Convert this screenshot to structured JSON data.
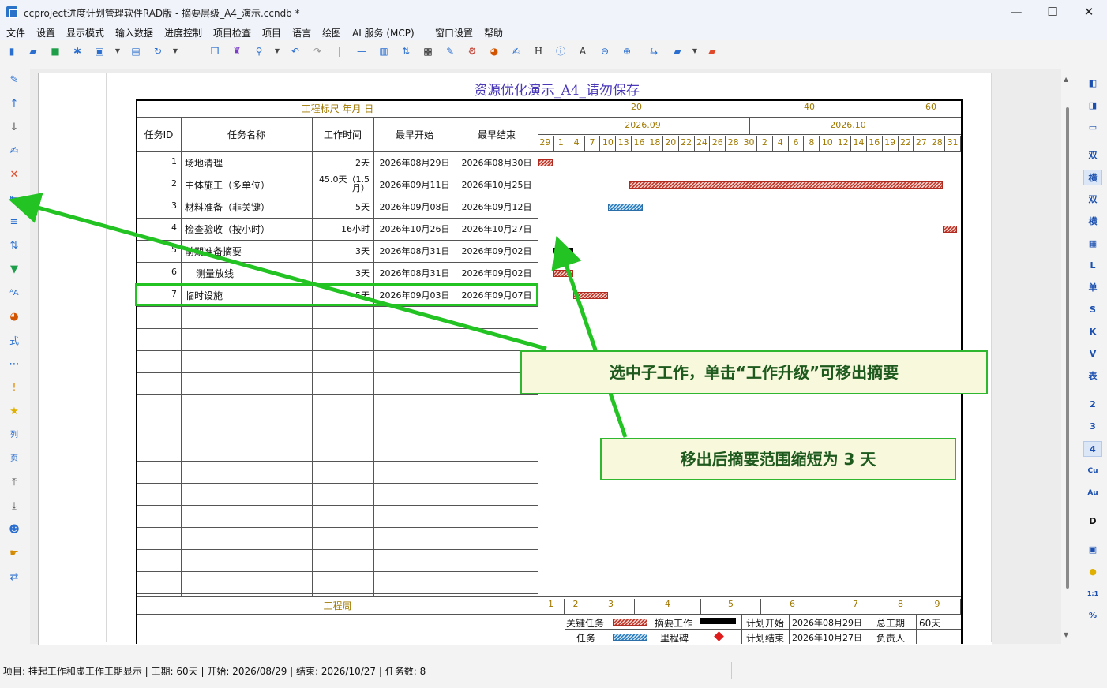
{
  "window": {
    "title": "ccproject进度计划管理软件RAD版 - 摘要层级_A4_演示.ccndb *",
    "minimize": "—",
    "maximize": "☐",
    "close": "✕"
  },
  "menu": [
    "文件",
    "设置",
    "显示模式",
    "输入数据",
    "进度控制",
    "项目检查",
    "项目",
    "语言",
    "绘图",
    "AI 服务 (MCP)",
    "窗口设置",
    "帮助"
  ],
  "toolbar_icons": [
    "new-file",
    "open-folder",
    "save",
    "asterisk",
    "image-export",
    "dropdown",
    "print",
    "refresh",
    "dropdown",
    "copy",
    "paint",
    "zoom",
    "dropdown",
    "undo",
    "redo",
    "separator",
    "line",
    "columns",
    "sort",
    "qr",
    "brush",
    "settings-doc",
    "palette",
    "edit",
    "H",
    "info",
    "A",
    "zoom-out",
    "zoom-in",
    "arrows",
    "folder",
    "dropdown",
    "folder-red"
  ],
  "chart": {
    "title": "资源优化演示_A4_请勿保存",
    "scale_title": "工程标尺 年月 日",
    "scale_numbers": [
      "20",
      "40",
      "60"
    ],
    "months": [
      "2026.09",
      "2026.10"
    ],
    "days": [
      "29",
      "1",
      "4",
      "7",
      "10",
      "13",
      "16",
      "18",
      "20",
      "22",
      "24",
      "26",
      "28",
      "30",
      "2",
      "4",
      "6",
      "8",
      "10",
      "12",
      "14",
      "16",
      "19",
      "22",
      "27",
      "28",
      "31"
    ],
    "columns": {
      "id": "任务ID",
      "name": "任务名称",
      "duration": "工作时间",
      "start": "最早开始",
      "finish": "最早结束"
    },
    "week_label": "工程周",
    "weeks": [
      "1",
      "2",
      "3",
      "4",
      "5",
      "6",
      "7",
      "8",
      "9"
    ]
  },
  "tasks": [
    {
      "id": "1",
      "name": "场地清理",
      "duration": "2天",
      "start": "2026年08月29日",
      "finish": "2026年08月30日",
      "type": "crit"
    },
    {
      "id": "2",
      "name": "主体施工（多单位）",
      "duration": "45.0天（1.5月）",
      "start": "2026年09月11日",
      "finish": "2026年10月25日",
      "type": "crit"
    },
    {
      "id": "3",
      "name": "材料准备（非关键）",
      "duration": "5天",
      "start": "2026年09月08日",
      "finish": "2026年09月12日",
      "type": "norm"
    },
    {
      "id": "4",
      "name": "检查验收（按小时）",
      "duration": "16小时",
      "start": "2026年10月26日",
      "finish": "2026年10月27日",
      "type": "crit"
    },
    {
      "id": "5",
      "name": "前期准备摘要",
      "duration": "3天",
      "start": "2026年08月31日",
      "finish": "2026年09月02日",
      "type": "summary"
    },
    {
      "id": "6",
      "name": "测量放线",
      "duration": "3天",
      "start": "2026年08月31日",
      "finish": "2026年09月02日",
      "type": "crit"
    },
    {
      "id": "7",
      "name": "临时设施",
      "duration": "5天",
      "start": "2026年09月03日",
      "finish": "2026年09月07日",
      "type": "crit"
    }
  ],
  "legend": {
    "critical": "关键任务",
    "summary": "摘要工作",
    "plan_start": "计划开始",
    "plan_start_val": "2026年08月29日",
    "total": "总工期",
    "total_val": "60天",
    "task": "任务",
    "milestone": "里程碑",
    "plan_end": "计划结束",
    "plan_end_val": "2026年10月27日",
    "owner": "负责人"
  },
  "annotations": {
    "callout1": "选中子工作，单击“工作升级”可移出摘要",
    "callout2": "移出后摘要范围缩短为 3 天"
  },
  "right_tools": [
    "双",
    "横",
    "双",
    "横",
    "L",
    "单",
    "S",
    "K",
    "V",
    "表",
    "2",
    "3",
    "4",
    "Cu",
    "Au",
    "D",
    "1:1",
    "%"
  ],
  "status": "项目: 挂起工作和虚工作工期显示 | 工期: 60天 | 开始: 2026/08/29 | 结束: 2026/10/27 | 任务数: 8",
  "colors": {
    "accent_green": "#22c322",
    "critical": "#c0392b",
    "normal": "#2b7fc0",
    "title": "#4a3ab8"
  }
}
